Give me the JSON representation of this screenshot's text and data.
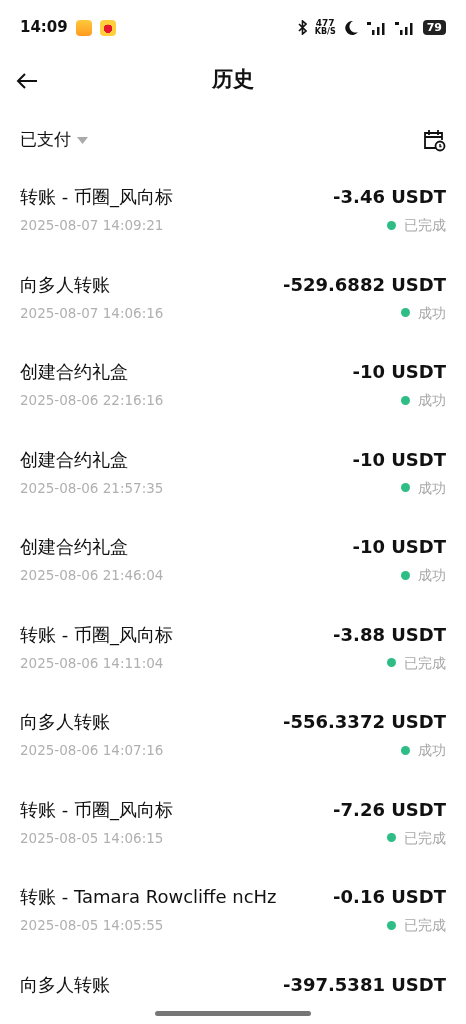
{
  "status_bar": {
    "time": "14:09",
    "net_speed": "477",
    "net_unit": "KB/S",
    "battery": "79"
  },
  "header": {
    "title": "历史"
  },
  "filter": {
    "label": "已支付"
  },
  "transactions": [
    {
      "title": "转账 - 币圈_风向标",
      "date": "2025-08-07 14:09:21",
      "amount": "-3.46 USDT",
      "status": "已完成"
    },
    {
      "title": "向多人转账",
      "date": "2025-08-07 14:06:16",
      "amount": "-529.6882 USDT",
      "status": "成功"
    },
    {
      "title": "创建合约礼盒",
      "date": "2025-08-06 22:16:16",
      "amount": "-10 USDT",
      "status": "成功"
    },
    {
      "title": "创建合约礼盒",
      "date": "2025-08-06 21:57:35",
      "amount": "-10 USDT",
      "status": "成功"
    },
    {
      "title": "创建合约礼盒",
      "date": "2025-08-06 21:46:04",
      "amount": "-10 USDT",
      "status": "成功"
    },
    {
      "title": "转账 - 币圈_风向标",
      "date": "2025-08-06 14:11:04",
      "amount": "-3.88 USDT",
      "status": "已完成"
    },
    {
      "title": "向多人转账",
      "date": "2025-08-06 14:07:16",
      "amount": "-556.3372 USDT",
      "status": "成功"
    },
    {
      "title": "转账 - 币圈_风向标",
      "date": "2025-08-05 14:06:15",
      "amount": "-7.26 USDT",
      "status": "已完成"
    },
    {
      "title": "转账 - Tamara Rowcliffe ncHz",
      "date": "2025-08-05 14:05:55",
      "amount": "-0.16 USDT",
      "status": "已完成"
    },
    {
      "title": "向多人转账",
      "amount": "-397.5381 USDT"
    }
  ]
}
